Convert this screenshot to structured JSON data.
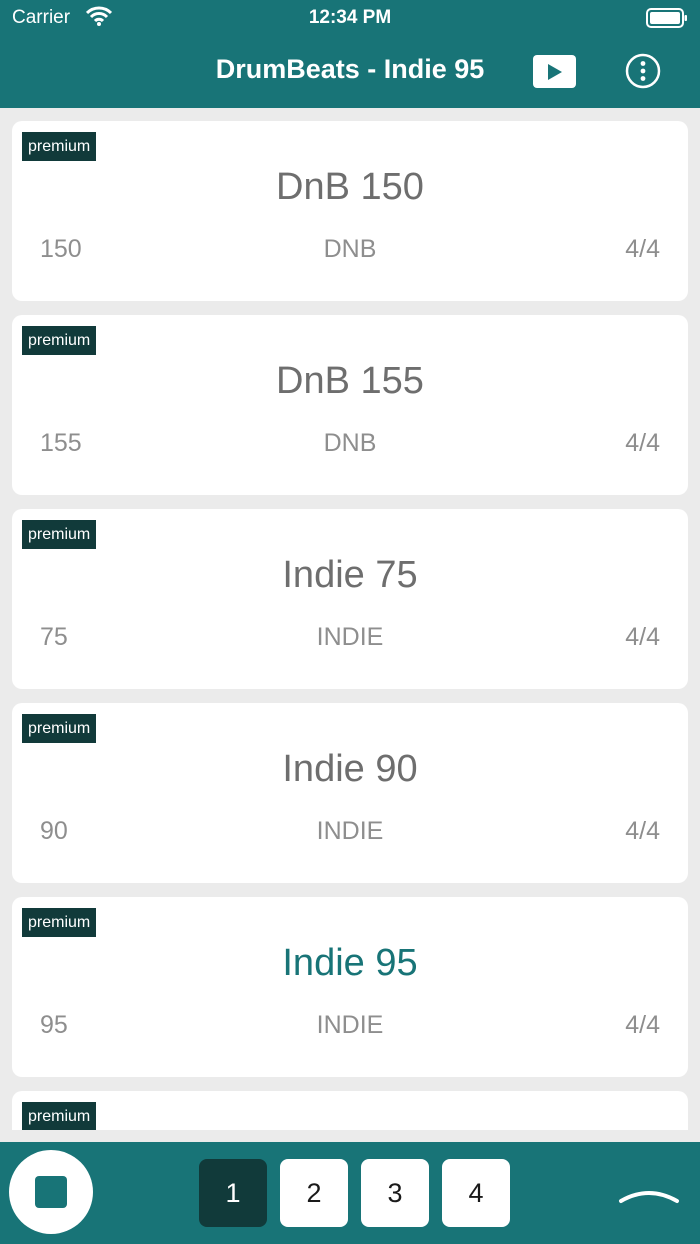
{
  "status_bar": {
    "carrier": "Carrier",
    "time": "12:34 PM",
    "wifi_icon": "wifi-icon",
    "battery_icon": "battery-icon"
  },
  "nav": {
    "title": "DrumBeats - Indie 95",
    "play_icon": "play-icon",
    "more_icon": "more-vertical-icon"
  },
  "beats": [
    {
      "badge": "premium",
      "name": "DnB 150",
      "bpm": "150",
      "genre": "DNB",
      "signature": "4/4",
      "active": false
    },
    {
      "badge": "premium",
      "name": "DnB 155",
      "bpm": "155",
      "genre": "DNB",
      "signature": "4/4",
      "active": false
    },
    {
      "badge": "premium",
      "name": "Indie 75",
      "bpm": "75",
      "genre": "INDIE",
      "signature": "4/4",
      "active": false
    },
    {
      "badge": "premium",
      "name": "Indie 90",
      "bpm": "90",
      "genre": "INDIE",
      "signature": "4/4",
      "active": false
    },
    {
      "badge": "premium",
      "name": "Indie 95",
      "bpm": "95",
      "genre": "INDIE",
      "signature": "4/4",
      "active": true
    },
    {
      "badge": "premium",
      "name": "",
      "bpm": "",
      "genre": "",
      "signature": "",
      "active": false
    }
  ],
  "bottom_bar": {
    "stop_icon": "stop-icon",
    "pages": [
      "1",
      "2",
      "3",
      "4"
    ],
    "selected_page": "1",
    "collapse_icon": "chevron-up-icon"
  },
  "colors": {
    "brand": "#187477",
    "badge": "#113a3a",
    "active_title": "#187477",
    "background": "#ebebeb"
  }
}
